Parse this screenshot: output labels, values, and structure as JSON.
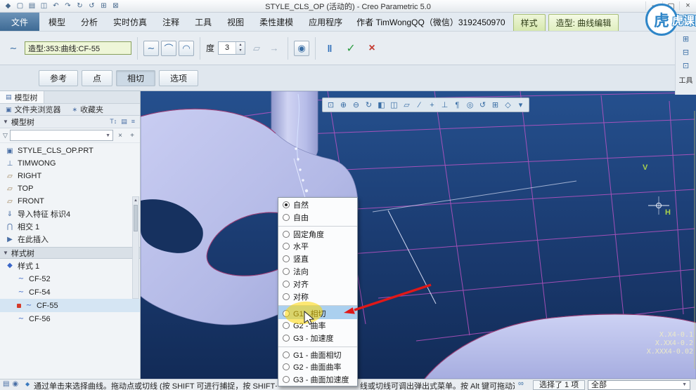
{
  "titlebar": {
    "title": "STYLE_CLS_OP (活动的) - Creo Parametric 5.0",
    "qat_icons": [
      {
        "name": "creo-logo-icon",
        "glyph": "◆"
      },
      {
        "name": "new-file-icon",
        "glyph": "▢"
      },
      {
        "name": "open-file-icon",
        "glyph": "▤"
      },
      {
        "name": "save-icon",
        "glyph": "◫"
      },
      {
        "name": "undo-icon",
        "glyph": "↶"
      },
      {
        "name": "redo-icon",
        "glyph": "↷"
      },
      {
        "name": "regenerate-icon",
        "glyph": "↻"
      },
      {
        "name": "refresh-icon",
        "glyph": "↺"
      },
      {
        "name": "windows-icon",
        "glyph": "⊞"
      },
      {
        "name": "close-window-icon",
        "glyph": "⊠"
      }
    ],
    "window_controls": [
      {
        "name": "minimize-button",
        "glyph": "–"
      },
      {
        "name": "maximize-button",
        "glyph": "▢"
      },
      {
        "name": "close-button",
        "glyph": "×"
      }
    ]
  },
  "ribbon": {
    "file_tab": "文件",
    "tabs": [
      {
        "label": "模型"
      },
      {
        "label": "分析"
      },
      {
        "label": "实时仿真"
      },
      {
        "label": "注释"
      },
      {
        "label": "工具"
      },
      {
        "label": "视图"
      },
      {
        "label": "柔性建模"
      },
      {
        "label": "应用程序"
      }
    ],
    "author_text": "作者 TimWongQQ（微信）3192450970",
    "context_tabs": [
      {
        "label": "样式",
        "active": false
      },
      {
        "label": "造型: 曲线编辑",
        "active": true
      }
    ],
    "right_rail": {
      "icons": [
        {
          "name": "datum-tools-icon",
          "glyph": "⊞"
        },
        {
          "name": "sketch-tools-icon",
          "glyph": "⊟"
        },
        {
          "name": "edit-tools-icon",
          "glyph": "⊡"
        }
      ],
      "label": "工具"
    }
  },
  "dashboard": {
    "curve_icon_glyph": "∼",
    "curve_field": "造型:353:曲线:CF-55",
    "mode_icons": [
      {
        "name": "free-curve-icon",
        "glyph": "∼"
      },
      {
        "name": "planar-curve-icon",
        "glyph": "⌒"
      },
      {
        "name": "cos-curve-icon",
        "glyph": "◠"
      }
    ],
    "degree_label": "度",
    "degree_value": "3",
    "aux_icons": [
      {
        "name": "weight-point-icon",
        "glyph": "▱"
      },
      {
        "name": "extend-curve-icon",
        "glyph": "→"
      }
    ],
    "preview_icon_glyph": "◉",
    "pause_label": "‖",
    "ok_label": "✓",
    "cancel_label": "×",
    "tabs": [
      {
        "label": "参考",
        "active": false
      },
      {
        "label": "点",
        "active": false
      },
      {
        "label": "相切",
        "active": true
      },
      {
        "label": "选项",
        "active": false
      }
    ]
  },
  "navigator": {
    "caret_glyph": "▼",
    "funnel_glyph": "▽",
    "tabs_row1": [
      {
        "name": "tab-model-tree",
        "icon": "▤",
        "label": "模型树",
        "active": true
      }
    ],
    "tabs_row2": [
      {
        "name": "tab-folder-browser",
        "icon": "▣",
        "label": "文件夹浏览器",
        "active": false
      },
      {
        "name": "tab-favorites",
        "icon": "∗",
        "label": "收藏夹",
        "active": false
      }
    ],
    "section_model_tree": "模型树",
    "section_style_tree": "样式树",
    "tree_toolbar_icons": [
      {
        "name": "tree-filter-icon",
        "glyph": "T↕"
      },
      {
        "name": "tree-columns-icon",
        "glyph": "▤"
      },
      {
        "name": "tree-settings-icon",
        "glyph": "≡"
      }
    ],
    "filter_clear_glyph": "×",
    "filter_add_glyph": "+",
    "tree_items": [
      {
        "name": "tree-item-part",
        "icon": "▣",
        "label": "STYLE_CLS_OP.PRT"
      },
      {
        "name": "tree-item-csys",
        "icon": "⊥",
        "label": "TIMWONG"
      },
      {
        "name": "tree-item-plane-right",
        "icon": "▱",
        "label": "RIGHT"
      },
      {
        "name": "tree-item-plane-top",
        "icon": "▱",
        "label": "TOP"
      },
      {
        "name": "tree-item-plane-front",
        "icon": "▱",
        "label": "FRONT"
      },
      {
        "name": "tree-item-import",
        "icon": "⇓",
        "label": "导入特征 标识4"
      },
      {
        "name": "tree-item-intersect",
        "icon": "⋂",
        "label": "相交 1"
      },
      {
        "name": "tree-item-insert-here",
        "icon": "▶",
        "label": "在此插入"
      }
    ],
    "style_items": [
      {
        "name": "tree-item-style-1",
        "icon": "◆",
        "label": "样式 1",
        "child": false,
        "active": false,
        "marked": false
      },
      {
        "name": "tree-item-curve-cf52",
        "icon": "∼",
        "label": "CF-52",
        "child": true,
        "active": false,
        "marked": false
      },
      {
        "name": "tree-item-curve-cf54",
        "icon": "∼",
        "label": "CF-54",
        "child": true,
        "active": false,
        "marked": false
      },
      {
        "name": "tree-item-curve-cf55",
        "icon": "∼",
        "label": "CF-55",
        "child": true,
        "active": true,
        "marked": true
      },
      {
        "name": "tree-item-curve-cf56",
        "icon": "∼",
        "label": "CF-56",
        "child": true,
        "active": false,
        "marked": false
      }
    ]
  },
  "graphics_toolbar": {
    "icons": [
      {
        "name": "refit-icon",
        "glyph": "⊡"
      },
      {
        "name": "zoom-in-icon",
        "glyph": "⊕"
      },
      {
        "name": "zoom-out-icon",
        "glyph": "⊖"
      },
      {
        "name": "repaint-icon",
        "glyph": "↻"
      },
      {
        "name": "display-style-icon",
        "glyph": "◧"
      },
      {
        "name": "section-icon",
        "glyph": "◫"
      },
      {
        "name": "plane-display-icon",
        "glyph": "▱"
      },
      {
        "name": "axis-display-icon",
        "glyph": "∕"
      },
      {
        "name": "point-display-icon",
        "glyph": "+"
      },
      {
        "name": "csys-display-icon",
        "glyph": "⊥"
      },
      {
        "name": "annotation-display-icon",
        "glyph": "¶"
      },
      {
        "name": "spin-center-icon",
        "glyph": "◎"
      },
      {
        "name": "orient-mode-icon",
        "glyph": "↺"
      },
      {
        "name": "view-manager-icon",
        "glyph": "⊞"
      },
      {
        "name": "perspective-icon",
        "glyph": "◇"
      },
      {
        "name": "more-options-icon",
        "glyph": "▾"
      }
    ]
  },
  "context_menu": {
    "items": [
      {
        "label": "自然",
        "selected": true,
        "highlighted": false,
        "sep_before": false
      },
      {
        "label": "自由",
        "selected": false,
        "highlighted": false,
        "sep_before": false
      },
      {
        "label": "固定角度",
        "selected": false,
        "highlighted": false,
        "sep_before": true
      },
      {
        "label": "水平",
        "selected": false,
        "highlighted": false,
        "sep_before": false
      },
      {
        "label": "竖直",
        "selected": false,
        "highlighted": false,
        "sep_before": false
      },
      {
        "label": "法向",
        "selected": false,
        "highlighted": false,
        "sep_before": false
      },
      {
        "label": "对齐",
        "selected": false,
        "highlighted": false,
        "sep_before": false
      },
      {
        "label": "对称",
        "selected": false,
        "highlighted": false,
        "sep_before": false
      },
      {
        "label": "G1 - 相切",
        "selected": false,
        "highlighted": true,
        "sep_before": true
      },
      {
        "label": "G2 - 曲率",
        "selected": false,
        "highlighted": false,
        "sep_before": false
      },
      {
        "label": "G3 - 加速度",
        "selected": false,
        "highlighted": false,
        "sep_before": false
      },
      {
        "label": "G1 - 曲面相切",
        "selected": false,
        "highlighted": false,
        "sep_before": true
      },
      {
        "label": "G2 - 曲面曲率",
        "selected": false,
        "highlighted": false,
        "sep_before": false
      },
      {
        "label": "G3 - 曲面加速度",
        "selected": false,
        "highlighted": false,
        "sep_before": false
      }
    ]
  },
  "viewport": {
    "coord_lines": [
      "X.X4-0.1",
      "X.XX4-0.2",
      "X.XXX4-0.02"
    ],
    "datum_v_label": "V",
    "datum_h_label": "H"
  },
  "statusbar": {
    "left_icons": [
      {
        "name": "navigator-toggle-icon",
        "glyph": "▤"
      },
      {
        "name": "browser-toggle-icon",
        "glyph": "◉"
      }
    ],
    "prompt_icon_glyph": "◆",
    "message_left": "通过单击来选择曲线。拖动点或切线 (按 SHIFT 可进行捕捉，按 SHIFT+ALT 可进行",
    "message_right": "线或切线可调出弹出式菜单。按 Alt 键可拖动选定平",
    "find_icon_glyph": "∞",
    "selection_status": "选择了 1 项",
    "filter_value": "全部"
  },
  "watermark": {
    "logo_char": "虎",
    "text": "虎课网"
  },
  "colors": {
    "viewport_bg": "#1b3c72",
    "model_surface": "#b6bce8",
    "wireframe": "#c455c8",
    "menu_highlight": "#abd0ef",
    "annotation_arrow": "#e01818",
    "annotation_highlight": "#ffd700"
  }
}
